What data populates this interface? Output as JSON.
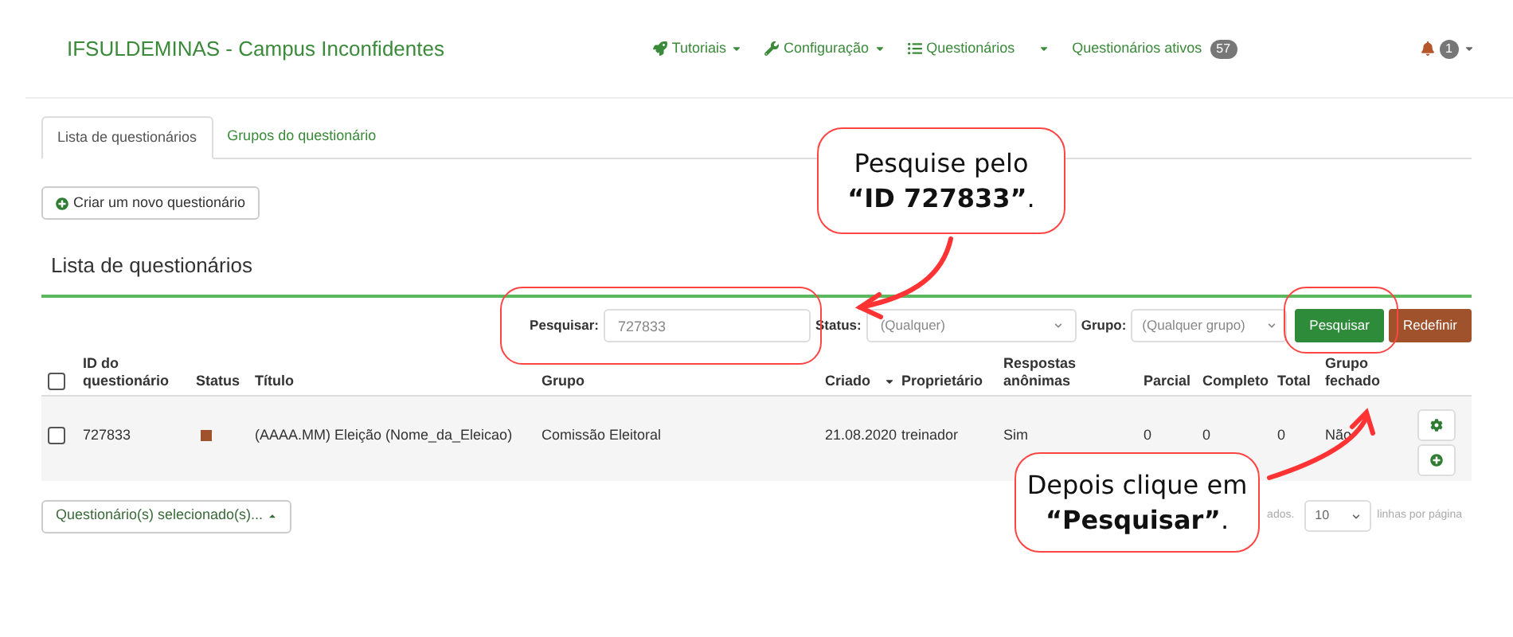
{
  "navbar": {
    "brand": "IFSULDEMINAS - Campus Inconfidentes",
    "items": [
      {
        "label": "Tutoriais",
        "kind": "dropdown"
      },
      {
        "label": "Configuração",
        "kind": "dropdown"
      },
      {
        "label": "Questionários",
        "kind": "dropdown"
      },
      {
        "label": "Questionários ativos",
        "kind": "link",
        "badge": "57"
      }
    ],
    "notifications": {
      "badge": "1"
    }
  },
  "tabs": [
    {
      "label": "Lista de questionários",
      "selected": true
    },
    {
      "label": "Grupos do questionário",
      "selected": false
    }
  ],
  "create_button": "Criar um novo questionário",
  "section_title": "Lista de questionários",
  "filters": {
    "search_label": "Pesquisar:",
    "search_value": "727833",
    "status_label": "Status:",
    "status_value": "(Qualquer)",
    "group_label": "Grupo:",
    "group_value": "(Qualquer grupo)",
    "search_button": "Pesquisar",
    "reset_button": "Redefinir"
  },
  "table": {
    "columns": [
      {
        "label": "ID do questionário",
        "sorted": false
      },
      {
        "label": "Status",
        "sorted": false
      },
      {
        "label": "Título",
        "sorted": false
      },
      {
        "label": "Grupo",
        "sorted": false
      },
      {
        "label": "Criado",
        "sorted": true
      },
      {
        "label": "Proprietário",
        "sorted": false
      },
      {
        "label": "Respostas anônimas",
        "sorted": false
      },
      {
        "label": "Parcial",
        "sorted": false
      },
      {
        "label": "Completo",
        "sorted": false
      },
      {
        "label": "Total",
        "sorted": false
      },
      {
        "label": "Grupo fechado",
        "sorted": false
      }
    ],
    "select_all_checked": false,
    "rows": [
      {
        "checked": false,
        "id": "727833",
        "color": "#a0522d",
        "title": "(AAAA.MM) Eleição (Nome_da_Eleicao)",
        "group": "Comissão Eleitoral",
        "created": "21.08.2020",
        "owner": "treinador",
        "anonymous": "Sim",
        "partial": "0",
        "complete": "0",
        "total": "0",
        "closed_group": "Não"
      }
    ]
  },
  "bulk_button": "Questionário(s) selecionado(s)...",
  "pagination": {
    "summary": "ados.",
    "per_page": "10",
    "per_page_label": "linhas por página"
  },
  "callouts": [
    {
      "lines": [
        "Pesquise pelo",
        "**“ID 727833”**."
      ]
    },
    {
      "lines": [
        "Depois clique em",
        "**“Pesquisar”**."
      ]
    }
  ]
}
